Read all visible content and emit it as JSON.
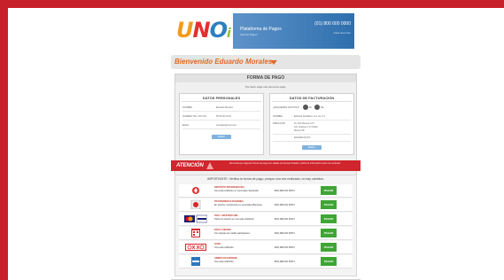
{
  "banner": {
    "logo_u": "U",
    "logo_n": "N",
    "logo_o": "O",
    "logo_i": "i",
    "title": "Plataforma de Pagos",
    "subtitle": "Internet Pagos",
    "phone": "(01) 800 000 0000",
    "site": "www.unoi.com"
  },
  "welcome": {
    "text": "Bienvenido Eduardo Morales"
  },
  "form": {
    "title": "FORMA DE PAGO",
    "hint": "Por favor elige una forma de pago.",
    "personal": {
      "title": "DATOS PERSONALES",
      "rows": [
        {
          "k": "NOMBRE",
          "v": "Eduardo Morales"
        },
        {
          "k": "NUMERO TEL. ACTUAL",
          "v": "55 50 00 00 00"
        },
        {
          "k": "EMAIL",
          "v": "emorales@unoi.com"
        }
      ],
      "button": "Editar"
    },
    "billing": {
      "title": "DATOS DE FACTURACIÓN",
      "question": "¿REQUIERES FACTURA?",
      "opt_yes": "Sí",
      "opt_no": "No",
      "rows": [
        {
          "k": "NOMBRE",
          "v": "Editorial Santillana, S.A. de C.V."
        },
        {
          "k": "DIRECCIÓN",
          "v": "Av. Río Mixcoac 274"
        },
        {
          "k": "",
          "v": "Col. Acacias C.P. 03240"
        },
        {
          "k": "",
          "v": "México DF"
        },
        {
          "k": "",
          "v": "ESA920101XXX"
        }
      ],
      "button": "Editar"
    }
  },
  "attention": {
    "title": "ATENCIÓN",
    "text": "Recuerda que algunas formas de pago son válidas por tiempo limitado; verifica la información antes de continuar."
  },
  "payments": {
    "title": "IMPORTANTE: Verifica la forma de pago, porque una vez realizado, no hay cambios.",
    "items": [
      {
        "icon": "santander-icon",
        "name": "DEPÓSITO REFERENCIADO",
        "desc": "Una sola exhibición en sucursales Santander",
        "amount": "$15,000.00 MXN",
        "btn": "PAGAR"
      },
      {
        "icon": "banamex-icon",
        "name": "TRASFERENCIA BANAMEX",
        "desc": "En efectivo, únicamente en sucursales Banamex",
        "amount": "$15,000.00 MXN",
        "btn": "PAGAR"
      },
      {
        "icon": "visa-mastercard-icon",
        "name": "VISA Y MASTERCARD",
        "desc": "Todos los bancos en una sola exhibición",
        "amount": "$15,000.00 MXN",
        "btn": "PAGAR"
      },
      {
        "icon": "meses-icon",
        "name": "PAGO A MESES",
        "desc": "Con tarjetas de crédito participantes",
        "amount": "$15,000.00 MXN",
        "btn": "PAGAR"
      },
      {
        "icon": "oxxo-icon",
        "name": "OXXO",
        "desc": "Una sola exhibición",
        "amount": "$15,000.00 MXN",
        "btn": "PAGAR"
      },
      {
        "icon": "amex-icon",
        "name": "AMERICAN EXPRESS",
        "desc": "Una sola exhibición",
        "amount": "$15,000.00 MXN",
        "btn": "PAGAR"
      }
    ]
  },
  "colors": {
    "frame": "#c8202a",
    "accent": "#e06a25",
    "pay_button": "#3fa535"
  }
}
